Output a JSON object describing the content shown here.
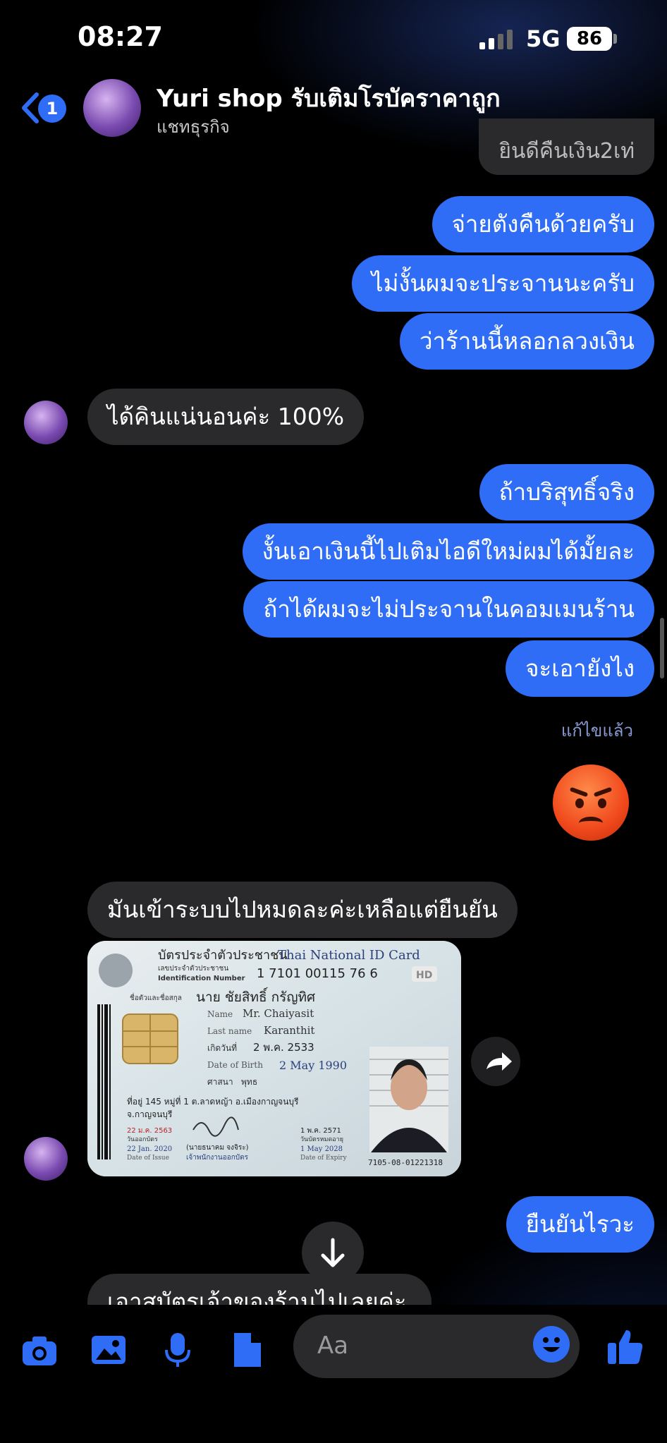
{
  "status_bar": {
    "time": "08:27",
    "network": "5G",
    "battery": "86"
  },
  "header": {
    "back_badge": "1",
    "title": "Yuri shop รับเติมโรบัคราคาถูก",
    "subtitle": "แชทธุรกิจ"
  },
  "messages": {
    "partial_top": "ยินดีคืนเงิน2เท่",
    "out_1": "จ่ายตังคืนด้วยครับ",
    "out_2": "ไม่งั้นผมจะประจานนะครับ",
    "out_3": "ว่าร้านนี้หลอกลวงเงิน",
    "in_1": "ได้คินแน่นอนค่ะ 100%",
    "out_4": "ถ้าบริสุทธิ์จริง",
    "out_5": "งั้นเอาเงินนี้ไปเติมไอดีใหม่ผมได้มั้ยละ",
    "out_6": "ถ้าได้ผมจะไม่ประจานในคอมเมนร้าน",
    "out_7": "จะเอายังไง",
    "edited": "แก้ไขแล้ว",
    "in_2": "มันเข้าระบบไปหมดละค่ะเหลือแต่ยืนยัน",
    "out_8": "ยืนยันไรวะ",
    "in_3_partial": "เอาสบัตรเจ้าของร้านไปเลยค่ะ"
  },
  "id_card": {
    "title_th": "บัตรประจำตัวประชาชน",
    "title_en": "Thai National ID Card",
    "id_label_th": "เลขประจำตัวประชาชน",
    "id_label_en": "Identification Number",
    "id_number": "1 7101 00115 76 6",
    "hd": "HD",
    "name_label_th": "ชื่อตัวและชื่อสกุล",
    "name_th": "นาย ชัยสิทธิ์ กรัญทิศ",
    "name_label": "Name",
    "name_en": "Mr. Chaiyasit",
    "lastname_label": "Last name",
    "lastname_en": "Karanthit",
    "dob_label_th": "เกิดวันที่",
    "dob_th": "2 พ.ค. 2533",
    "dob_label": "Date of Birth",
    "dob_en": "2 May 1990",
    "religion_label": "ศาสนา",
    "religion": "พุทธ",
    "address": "ที่อยู่ 145 หมู่ที่ 1 ต.ลาดหญ้า อ.เมืองกาญจนบุรี",
    "province": "จ.กาญจนบุรี",
    "issue_th": "22 ม.ค. 2563",
    "issue_label_th": "วันออกบัตร",
    "issue_en": "22 Jan. 2020",
    "issue_label": "Date of Issue",
    "officer": "(นายธนาคม จงจิระ)",
    "officer_title": "เจ้าพนักงานออกบัตร",
    "expiry_th": "1 พ.ค. 2571",
    "expiry_label_th": "วันบัตรหมดอายุ",
    "expiry_en": "1 May 2028",
    "expiry_label": "Date of Expiry",
    "serial": "7105-08-01221318"
  },
  "composer": {
    "placeholder": "Aa"
  },
  "colors": {
    "accent": "#2f6df6",
    "incoming_bubble": "#2a2a2c",
    "background": "#000000"
  },
  "icons": [
    "back-chevron-icon",
    "camera-icon",
    "gallery-icon",
    "microphone-icon",
    "document-icon",
    "emoji-icon",
    "thumbs-up-icon",
    "share-icon",
    "arrow-down-icon"
  ]
}
